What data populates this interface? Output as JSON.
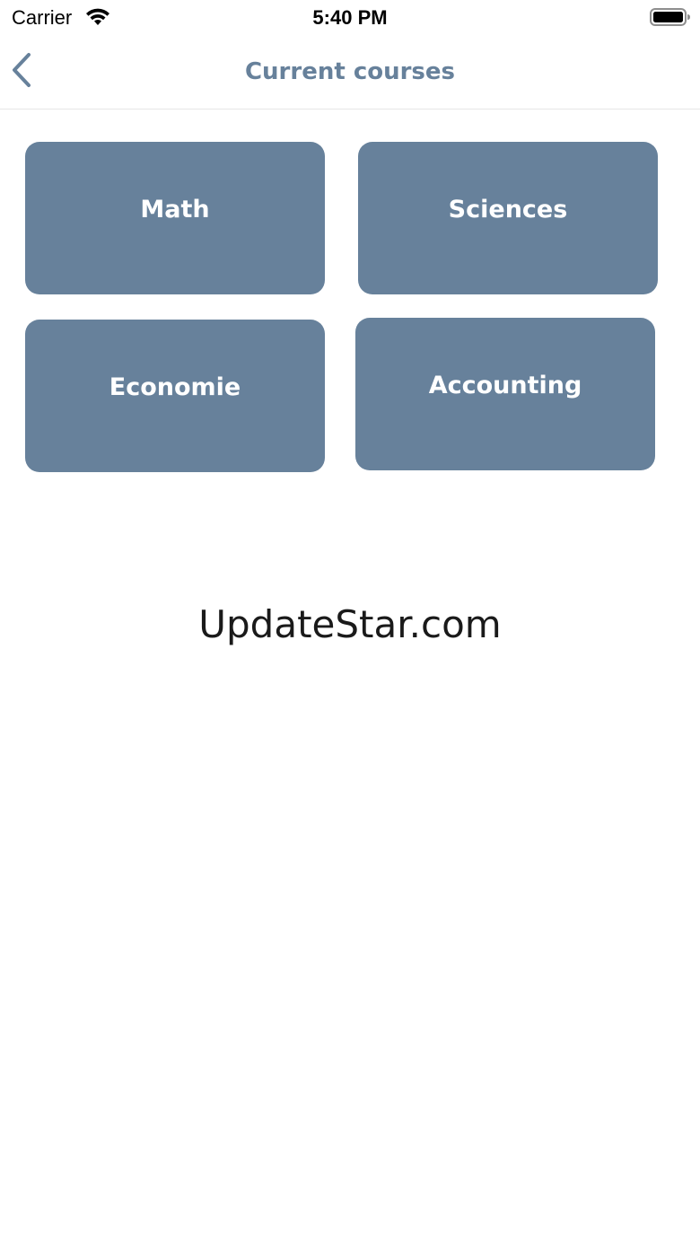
{
  "status_bar": {
    "carrier": "Carrier",
    "time": "5:40 PM",
    "wifi_icon": "wifi-icon",
    "battery_icon": "battery-icon"
  },
  "nav": {
    "back_icon": "chevron-left-icon",
    "title": "Current courses"
  },
  "courses": [
    {
      "label": "Math"
    },
    {
      "label": "Sciences"
    },
    {
      "label": "Economie"
    },
    {
      "label": "Accounting"
    }
  ],
  "watermark": "UpdateStar.com",
  "colors": {
    "accent": "#67819b",
    "card_text": "#ffffff",
    "background": "#ffffff"
  }
}
